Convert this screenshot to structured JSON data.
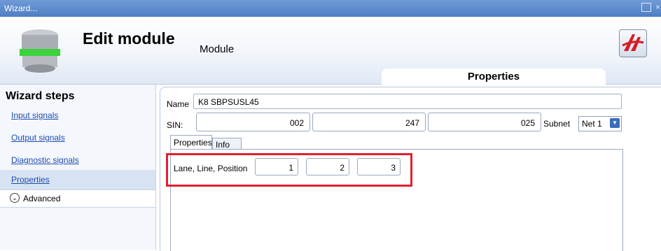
{
  "window": {
    "title": "Wizard..."
  },
  "header": {
    "title": "Edit module",
    "subtitle": "Module",
    "properties_tab": "Properties"
  },
  "sidebar": {
    "heading": "Wizard steps",
    "items": [
      {
        "label": "Input signals"
      },
      {
        "label": "Output signals"
      },
      {
        "label": "Diagnostic signals"
      },
      {
        "label": "Properties"
      }
    ],
    "advanced": "Advanced"
  },
  "form": {
    "name_label": "Name",
    "name_value": "K8 SBPSUSL45",
    "sin_label": "SIN:",
    "sin_values": [
      "002",
      "247",
      "025"
    ],
    "subnet_label": "Subnet",
    "subnet_value": "Net 1"
  },
  "tabs": [
    {
      "label": "Properties"
    },
    {
      "label": "Info"
    }
  ],
  "position": {
    "label": "Lane, Line, Position",
    "values": [
      "1",
      "2",
      "3"
    ]
  },
  "colors": {
    "highlight": "#e02030",
    "titlebar": "#5b8ccd",
    "link": "#1e4cb0"
  }
}
